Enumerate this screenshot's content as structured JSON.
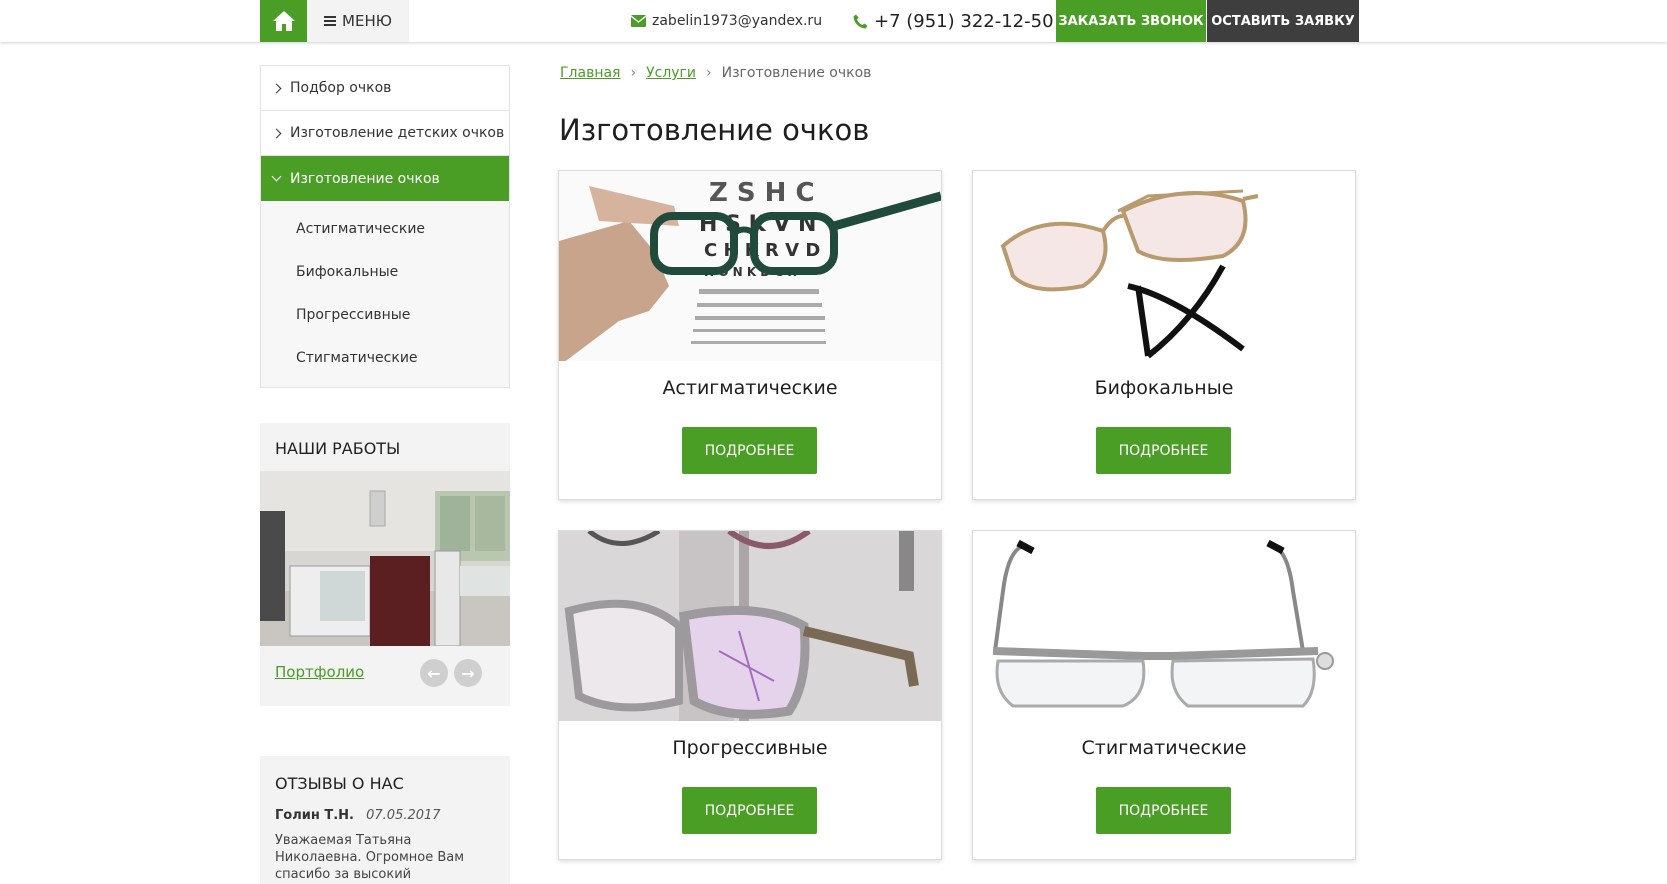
{
  "header": {
    "menu_label": "МЕНЮ",
    "email": "zabelin1973@yandex.ru",
    "phone": "+7 (951) 322-12-50",
    "call_button": "ЗАКАЗАТЬ ЗВОНОК",
    "request_button": "ОСТАВИТЬ ЗАЯВКУ"
  },
  "sidebar": {
    "items": [
      {
        "label": "Подбор очков"
      },
      {
        "label": "Изготовление детских очков"
      },
      {
        "label": "Изготовление очков"
      }
    ],
    "subitems": [
      {
        "label": "Астигматические"
      },
      {
        "label": "Бифокальные"
      },
      {
        "label": "Прогрессивные"
      },
      {
        "label": "Стигматические"
      }
    ]
  },
  "works": {
    "title": "НАШИ РАБОТЫ",
    "link": "Портфолио"
  },
  "reviews": {
    "title": "ОТЗЫВЫ О НАС",
    "author": "Голин Т.Н.",
    "date": "07.05.2017",
    "text": "Уважаемая Татьяна Николаевна. Огромное Вам спасибо за высокий"
  },
  "breadcrumb": {
    "home": "Главная",
    "services": "Услуги",
    "current": "Изготовление очков",
    "separator": "›"
  },
  "main": {
    "title": "Изготовление очков",
    "cards": [
      {
        "title": "Астигматические",
        "button": "ПОДРОБНЕЕ"
      },
      {
        "title": "Бифокальные",
        "button": "ПОДРОБНЕЕ"
      },
      {
        "title": "Прогрессивные",
        "button": "ПОДРОБНЕЕ"
      },
      {
        "title": "Стигматические",
        "button": "ПОДРОБНЕЕ"
      }
    ]
  },
  "colors": {
    "accent": "#4a9e25",
    "dark": "#3e3e3e"
  }
}
